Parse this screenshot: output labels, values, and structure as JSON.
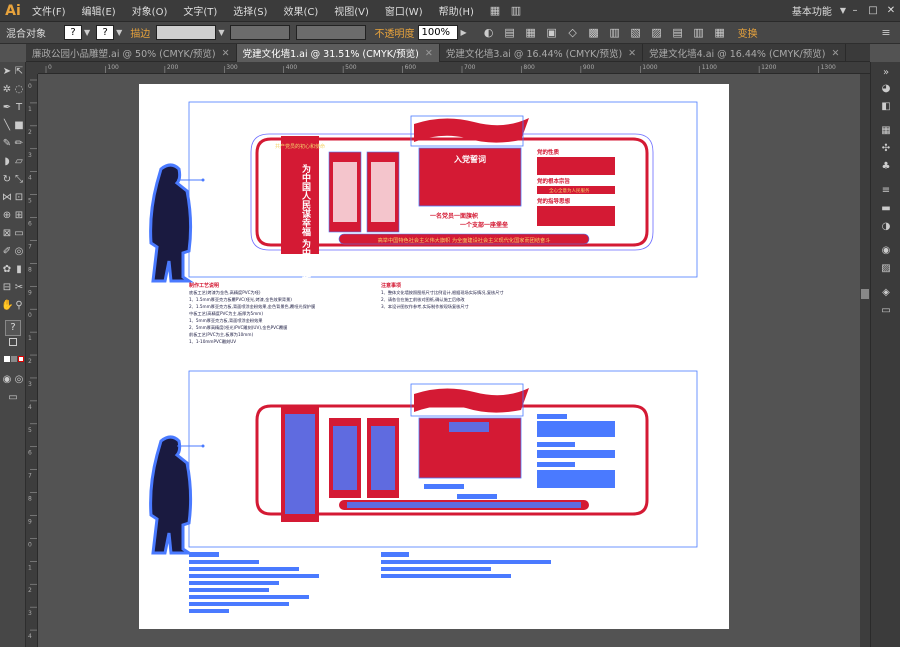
{
  "app": {
    "logo": "Ai"
  },
  "menu": [
    "文件(F)",
    "编辑(E)",
    "对象(O)",
    "文字(T)",
    "选择(S)",
    "效果(C)",
    "视图(V)",
    "窗口(W)",
    "帮助(H)"
  ],
  "workspace": "基本功能",
  "window_controls": [
    "–",
    "□",
    "✕"
  ],
  "control_bar": {
    "object_type": "混合对象",
    "stroke_label": "描边",
    "opacity_label": "不透明度",
    "opacity_value": "100%",
    "transform_label": "变换"
  },
  "tabs": [
    {
      "label": "廉政公园小品雕塑.ai @ 50% (CMYK/预览)",
      "active": false
    },
    {
      "label": "党建文化墙1.ai @ 31.51% (CMYK/预览)",
      "active": true
    },
    {
      "label": "党建文化墙3.ai @ 16.44% (CMYK/预览)",
      "active": false
    },
    {
      "label": "党建文化墙4.ai @ 16.44% (CMYK/预览)",
      "active": false
    }
  ],
  "ruler_h_labels": [
    "0",
    "100",
    "200",
    "300",
    "400",
    "500",
    "600",
    "700",
    "800",
    "900",
    "1000",
    "1100",
    "1200",
    "1300"
  ],
  "ruler_v_labels": [
    "0",
    "1",
    "2",
    "3",
    "4",
    "5",
    "6",
    "7",
    "8",
    "9",
    "0",
    "1",
    "2",
    "3",
    "4",
    "5",
    "6",
    "7",
    "8",
    "9",
    "0",
    "1",
    "2",
    "3",
    "4"
  ],
  "artwork": {
    "vertical_slogan": "为中国人民谋幸福 为中华民族谋复兴",
    "vertical_header": "共产党员的初心和使命",
    "banner_title": "入党誓词",
    "center_slogan_1": "一名党员一面旗帜",
    "center_slogan_2": "一个支部一座堡垒",
    "bottom_banner": "高举中国特色社会主义伟大旗帜 为全面建设社会主义现代化国家而团结奋斗",
    "right_items": [
      "党的性质",
      "党的根本宗旨",
      "党的指导思想"
    ],
    "right_item_2": "全心全意为人民服务",
    "notes_left_title": "制作工艺说明",
    "notes_left_lines": [
      "底板工艺(烤漆为金色,高精度PVC为哑)",
      "1、1.5mm厚亚克力板覆PVC(哑光,烤漆,金色效果背景)",
      "2、1.5mm厚亚克力板,背面喷涂金粉效果,金色背景色,覆哑光保护膜",
      "中板工艺(高精度PVC为主,板厚为5mm)",
      "1、5mm厚亚克力板,背面喷涂金粉效果",
      "2、5mm厚高精度(哑光)PVC雕刻(UV),金色PVC覆膜",
      "前板工艺(PVC为主,板厚为10mm)",
      "1、1-10mmPVC雕刻UV"
    ],
    "notes_right_title": "注意事项",
    "notes_right_lines": [
      "1、整体文化墙按照图纸尺寸比例设计,根据现场实际情况,复核尺寸",
      "2、请各位在施工前核对图纸,确认施工后修改",
      "3、本设计图仅作参考,实际制作按现场复核尺寸"
    ]
  },
  "colors": {
    "primary_red": "#d41a34",
    "selection_blue": "#4a7aff",
    "gold_text": "#f5d36b",
    "dark_navy": "#1a1a40"
  }
}
